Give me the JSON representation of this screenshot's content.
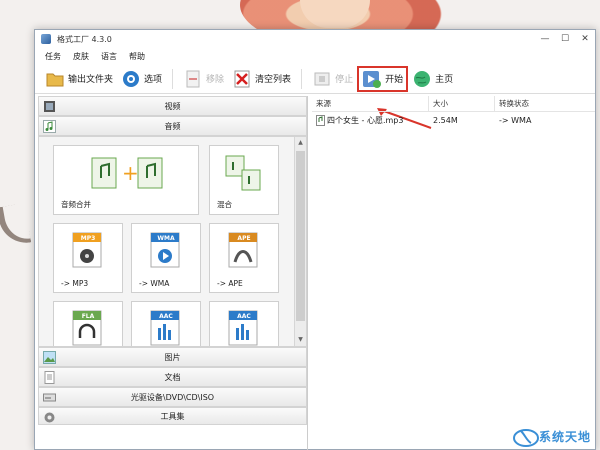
{
  "window": {
    "title": "格式工厂 4.3.0"
  },
  "menu": [
    "任务",
    "皮肤",
    "语言",
    "帮助"
  ],
  "toolbar": {
    "output_folder": "输出文件夹",
    "options": "选项",
    "remove": "移除",
    "clear_list": "清空列表",
    "stop": "停止",
    "start": "开始",
    "home": "主页"
  },
  "categories": {
    "video": "视频",
    "audio": "音频",
    "image": "图片",
    "document": "文档",
    "disc": "光驱设备\\DVD\\CD\\ISO",
    "tools": "工具集"
  },
  "tiles": {
    "merge": {
      "label": "音频合并"
    },
    "mix": {
      "label": "混合"
    },
    "mp3": {
      "label": "-> MP3",
      "badge": "MP3"
    },
    "wma": {
      "label": "-> WMA",
      "badge": "WMA"
    },
    "ape": {
      "label": "-> APE",
      "badge": "APE"
    },
    "flac": {
      "badge": "FLA"
    },
    "aac1": {
      "badge": "AAC"
    },
    "aac2": {
      "badge": "AAC"
    }
  },
  "list": {
    "headers": [
      "来源",
      "大小",
      "转换状态"
    ],
    "rows": [
      {
        "source": "四个女生 - 心愿.mp3",
        "size": "2.54M",
        "status": "-> WMA"
      }
    ]
  },
  "watermark": {
    "text": "系统天地"
  },
  "colors": {
    "highlight": "#d9352b",
    "accent": "#2c7bc9",
    "music_green": "#6aa84f"
  }
}
